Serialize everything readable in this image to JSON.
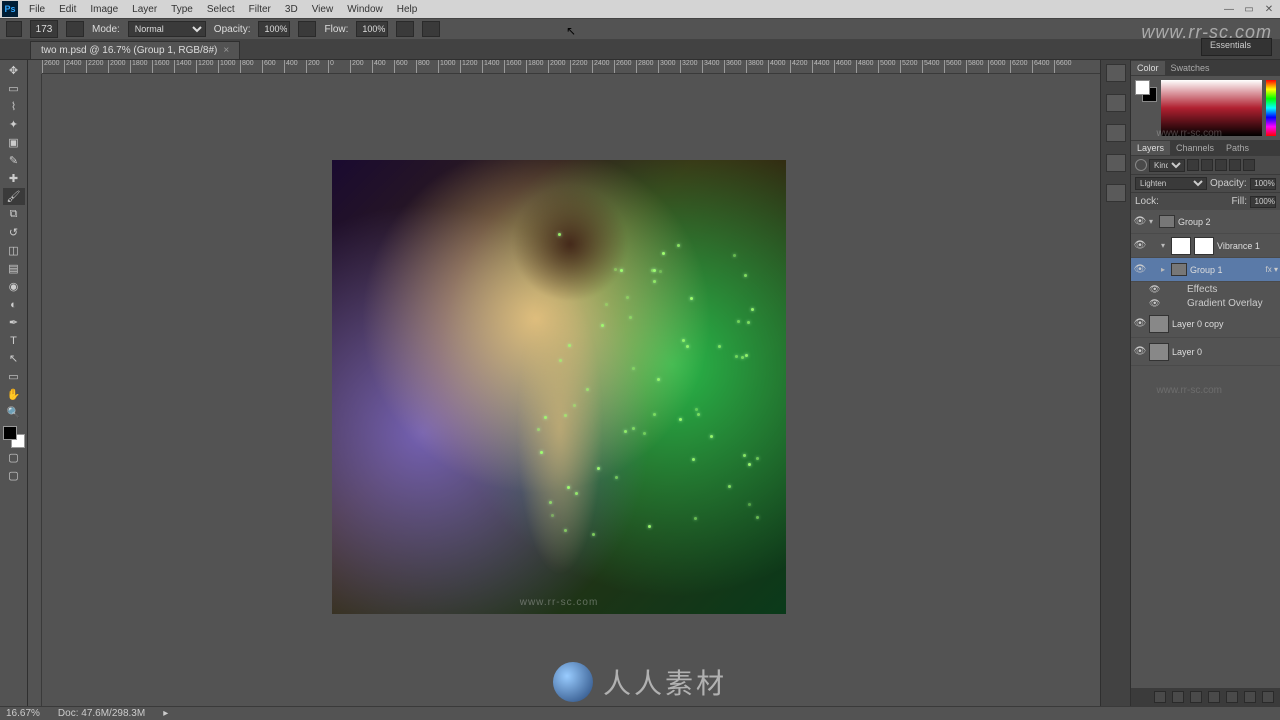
{
  "menu": {
    "items": [
      "File",
      "Edit",
      "Image",
      "Layer",
      "Type",
      "Select",
      "Filter",
      "3D",
      "View",
      "Window",
      "Help"
    ]
  },
  "options": {
    "brush_size": "173",
    "mode_label": "Mode:",
    "mode_value": "Normal",
    "opacity_label": "Opacity:",
    "opacity_value": "100%",
    "flow_label": "Flow:",
    "flow_value": "100%"
  },
  "document": {
    "tab_title": "two m.psd @ 16.7% (Group 1, RGB/8#)"
  },
  "workspace_switcher": "Essentials",
  "ruler_ticks": [
    "2600",
    "2400",
    "2200",
    "2000",
    "1800",
    "1600",
    "1400",
    "1200",
    "1000",
    "800",
    "600",
    "400",
    "200",
    "0",
    "200",
    "400",
    "600",
    "800",
    "1000",
    "1200",
    "1400",
    "1600",
    "1800",
    "2000",
    "2200",
    "2400",
    "2600",
    "2800",
    "3000",
    "3200",
    "3400",
    "3600",
    "3800",
    "4000",
    "4200",
    "4400",
    "4600",
    "4800",
    "5000",
    "5200",
    "5400",
    "5600",
    "5800",
    "6000",
    "6200",
    "6400",
    "6600"
  ],
  "right_panels": {
    "color": {
      "tabs": [
        "Color",
        "Swatches"
      ]
    },
    "layers": {
      "tabs": [
        "Layers",
        "Channels",
        "Paths"
      ],
      "filter_kind": "Kind",
      "blend_mode": "Lighten",
      "opacity_label": "Opacity:",
      "opacity_value": "100%",
      "lock_label": "Lock:",
      "fill_label": "Fill:",
      "fill_value": "100%",
      "items": [
        {
          "type": "group",
          "name": "Group 2",
          "indent": 0,
          "expanded": true
        },
        {
          "type": "adjustment",
          "name": "Vibrance 1",
          "indent": 1
        },
        {
          "type": "group",
          "name": "Group 1",
          "indent": 1,
          "selected": true,
          "fx": true,
          "expanded": false
        },
        {
          "type": "effects_header",
          "name": "Effects",
          "indent": 2
        },
        {
          "type": "effect",
          "name": "Gradient Overlay",
          "indent": 2
        },
        {
          "type": "layer",
          "name": "Layer 0 copy",
          "indent": 0
        },
        {
          "type": "layer",
          "name": "Layer 0",
          "indent": 0
        }
      ]
    }
  },
  "status": {
    "zoom": "16.67%",
    "doc_info": "Doc: 47.6M/298.3M"
  },
  "watermarks": {
    "url": "www.rr-sc.com",
    "brand": "人人素材",
    "canvas_wm": "www.rr-sc.com"
  },
  "tools": [
    "move",
    "marquee",
    "lasso",
    "wand",
    "crop",
    "eyedropper",
    "heal",
    "brush",
    "stamp",
    "history",
    "eraser",
    "gradient",
    "blur",
    "dodge",
    "pen",
    "type",
    "path",
    "shape",
    "hand",
    "zoom"
  ]
}
